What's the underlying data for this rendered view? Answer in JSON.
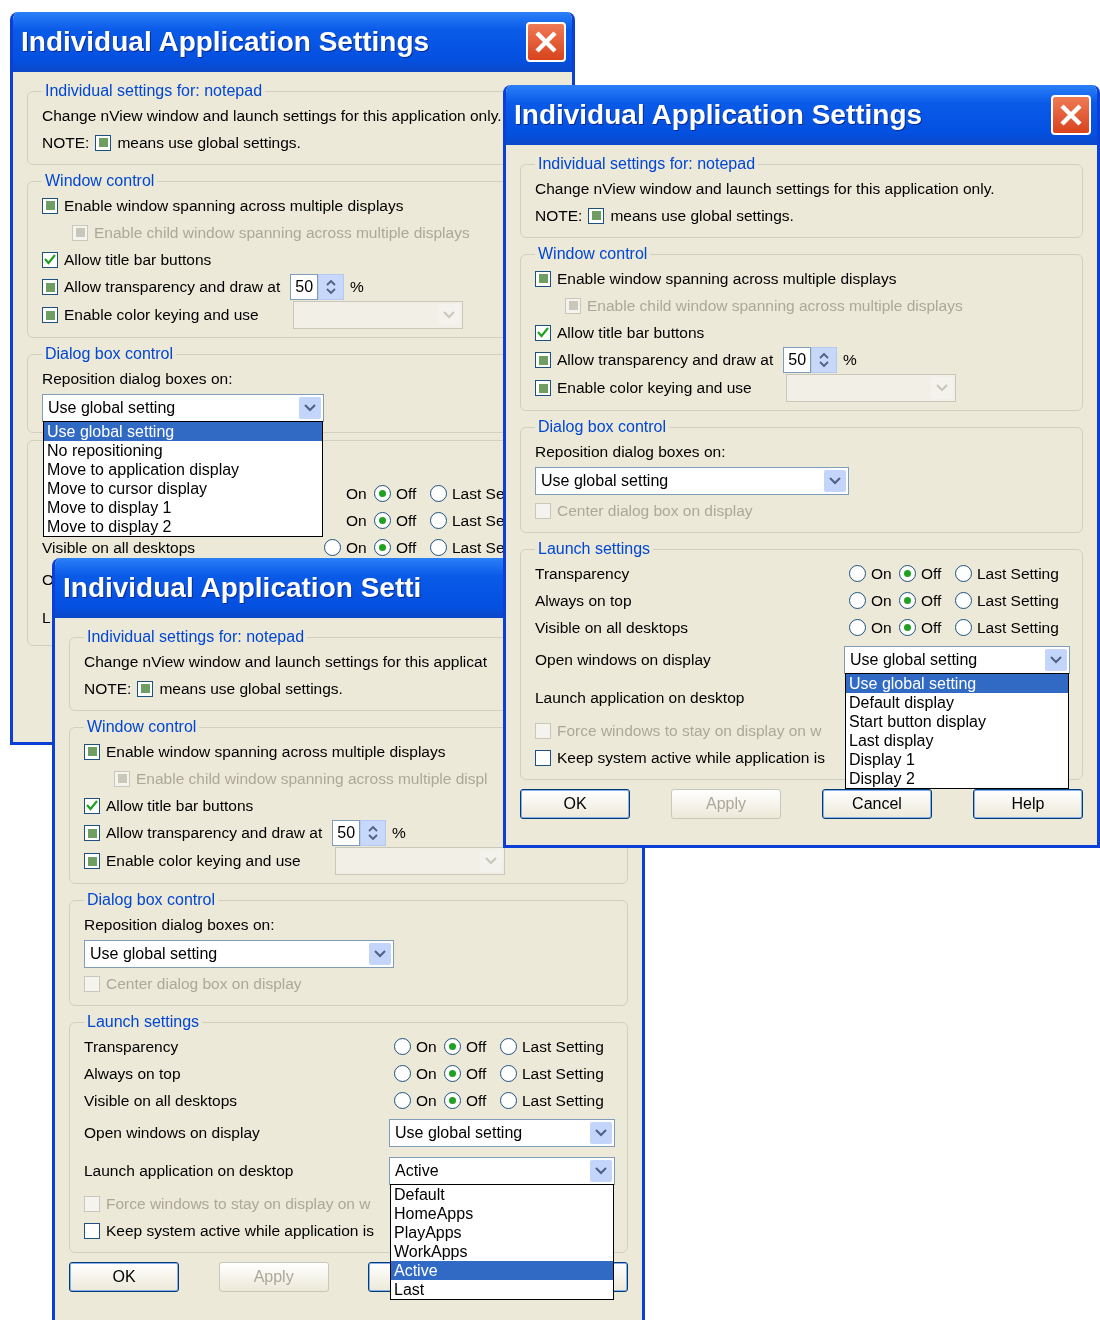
{
  "windows": [
    {
      "title": "Individual Application Settings",
      "close_button": true,
      "sections": [
        {
          "legend": "Individual settings for: notepad",
          "items": [
            {
              "kind": "text",
              "text": "Change nView window and launch settings for this application only."
            },
            {
              "kind": "note",
              "label": "NOTE:",
              "text": "means use global settings."
            }
          ]
        },
        {
          "legend": "Window control",
          "items": [
            {
              "kind": "checkbox",
              "checked": false,
              "indeterminate": true,
              "disabled": false,
              "label": "Enable window spanning across multiple displays",
              "children": [
                {
                  "kind": "checkbox",
                  "checked": false,
                  "indeterminate": true,
                  "disabled": true,
                  "label": "Enable child window spanning across multiple displays"
                }
              ]
            },
            {
              "kind": "checkbox",
              "checked": true,
              "disabled": false,
              "label": "Allow title bar buttons"
            },
            {
              "kind": "spin",
              "checked": false,
              "indeterminate": true,
              "label": "Allow transparency and draw at",
              "value": "50",
              "unit": "%"
            },
            {
              "kind": "select_check",
              "checked": false,
              "indeterminate": true,
              "label": "Enable color keying and use",
              "select_disabled": true
            }
          ]
        },
        {
          "legend": "Dialog box control",
          "items": [
            {
              "kind": "label",
              "text": "Reposition dialog boxes on:"
            },
            {
              "kind": "select",
              "value": "Use global setting",
              "list": [
                {
                  "label": "Use global setting",
                  "selected": true
                },
                {
                  "label": "No repositioning",
                  "selected": false
                },
                {
                  "label": "Move to application display",
                  "selected": false
                },
                {
                  "label": "Move to cursor display",
                  "selected": false
                },
                {
                  "label": "Move to display 1",
                  "selected": false
                },
                {
                  "label": "Move to display 2",
                  "selected": false
                }
              ]
            }
          ]
        },
        {
          "items": [
            {
              "kind": "radio_row",
              "options": [
                {
                  "label": "On"
                },
                {
                  "label": "Off",
                  "selected": true
                },
                {
                  "label": "Last Se",
                  "selected": false
                }
              ]
            },
            {
              "kind": "radio_row",
              "options": [
                {
                  "label": "On"
                },
                {
                  "label": "Off",
                  "selected": true
                },
                {
                  "label": "Last Se",
                  "selected": false
                }
              ]
            },
            {
              "kind": "radio_row",
              "label": "Visible on all desktops",
              "options": [
                {
                  "label": "On",
                  "selected": false
                },
                {
                  "label": "Off",
                  "selected": true
                },
                {
                  "label": "Last Se",
                  "selected": false
                }
              ]
            },
            {
              "kind": "select_row",
              "label": "O"
            },
            {
              "kind": "select_row",
              "label": "L"
            }
          ]
        }
      ]
    },
    {
      "title": "Individual Application Settings",
      "close_button": true,
      "sections": [
        {
          "legend": "Individual settings for: notepad",
          "items": [
            {
              "kind": "text",
              "text": "Change nView window and launch settings for this application only."
            },
            {
              "kind": "note",
              "label": "NOTE:",
              "text": "means use global settings."
            }
          ]
        },
        {
          "legend": "Window control",
          "items": [
            {
              "kind": "checkbox",
              "checked": false,
              "indeterminate": true,
              "disabled": false,
              "label": "Enable window spanning across multiple displays",
              "children": [
                {
                  "kind": "checkbox",
                  "checked": false,
                  "indeterminate": true,
                  "disabled": true,
                  "label": "Enable child window spanning across multiple displays"
                }
              ]
            },
            {
              "kind": "checkbox",
              "checked": true,
              "disabled": false,
              "label": "Allow title bar buttons"
            },
            {
              "kind": "spin",
              "checked": false,
              "indeterminate": true,
              "label": "Allow transparency and draw at",
              "value": "50",
              "unit": "%"
            },
            {
              "kind": "select_check",
              "checked": false,
              "indeterminate": true,
              "label": "Enable color keying and use",
              "select_disabled": true
            }
          ]
        },
        {
          "legend": "Dialog box control",
          "items": [
            {
              "kind": "label",
              "text": "Reposition dialog boxes on:"
            },
            {
              "kind": "select",
              "value": "Use global setting"
            },
            {
              "kind": "checkbox",
              "checked": false,
              "indeterminate": false,
              "disabled": true,
              "label": "Center dialog box on display"
            }
          ]
        },
        {
          "legend": "Launch settings",
          "items": [
            {
              "kind": "radio_row",
              "label": "Transparency",
              "options": [
                {
                  "label": "On",
                  "selected": false
                },
                {
                  "label": "Off",
                  "selected": true
                },
                {
                  "label": "Last Setting",
                  "selected": false
                }
              ]
            },
            {
              "kind": "radio_row",
              "label": "Always on top",
              "options": [
                {
                  "label": "On",
                  "selected": false
                },
                {
                  "label": "Off",
                  "selected": true
                },
                {
                  "label": "Last Setting",
                  "selected": false
                }
              ]
            },
            {
              "kind": "radio_row",
              "label": "Visible on all desktops",
              "options": [
                {
                  "label": "On",
                  "selected": false
                },
                {
                  "label": "Off",
                  "selected": true
                },
                {
                  "label": "Last Setting",
                  "selected": false
                }
              ]
            },
            {
              "kind": "select_row",
              "label": "Open windows on display",
              "value": "Use global setting",
              "list": [
                {
                  "label": "Use global setting",
                  "selected": true
                },
                {
                  "label": "Default display",
                  "selected": false
                },
                {
                  "label": "Start button display",
                  "selected": false
                },
                {
                  "label": "Last display",
                  "selected": false
                },
                {
                  "label": "Display 1",
                  "selected": false
                },
                {
                  "label": "Display 2",
                  "selected": false
                }
              ]
            },
            {
              "kind": "select_row",
              "label": "Launch application on desktop"
            },
            {
              "kind": "checkbox",
              "checked": false,
              "indeterminate": false,
              "disabled": true,
              "label": "Force windows to stay on display on w"
            },
            {
              "kind": "checkbox",
              "checked": false,
              "indeterminate": false,
              "disabled": false,
              "label": "Keep system active while application is"
            }
          ]
        }
      ],
      "buttons": [
        {
          "label": "OK",
          "disabled": false
        },
        {
          "label": "Apply",
          "disabled": true
        },
        {
          "label": "Cancel",
          "disabled": false
        },
        {
          "label": "Help",
          "disabled": false
        }
      ]
    },
    {
      "title": "Individual Application Setti",
      "sections": [
        {
          "legend": "Individual settings for: notepad",
          "items": [
            {
              "kind": "text",
              "text": "Change nView window and launch settings for this applicat"
            },
            {
              "kind": "note",
              "label": "NOTE:",
              "text": "means use global settings."
            }
          ]
        },
        {
          "legend": "Window control",
          "items": [
            {
              "kind": "checkbox",
              "checked": false,
              "indeterminate": true,
              "disabled": false,
              "label": "Enable window spanning across multiple displays",
              "children": [
                {
                  "kind": "checkbox",
                  "checked": false,
                  "indeterminate": true,
                  "disabled": true,
                  "label": "Enable child window spanning across multiple displ"
                }
              ]
            },
            {
              "kind": "checkbox",
              "checked": true,
              "disabled": false,
              "label": "Allow title bar buttons"
            },
            {
              "kind": "spin",
              "checked": false,
              "indeterminate": true,
              "label": "Allow transparency and draw at",
              "value": "50",
              "unit": "%"
            },
            {
              "kind": "select_check",
              "checked": false,
              "indeterminate": true,
              "label": "Enable color keying and use",
              "select_disabled": true
            }
          ]
        },
        {
          "legend": "Dialog box control",
          "items": [
            {
              "kind": "label",
              "text": "Reposition dialog boxes on:"
            },
            {
              "kind": "select",
              "value": "Use global setting"
            },
            {
              "kind": "checkbox",
              "checked": false,
              "indeterminate": false,
              "disabled": true,
              "label": "Center dialog box on display"
            }
          ]
        },
        {
          "legend": "Launch settings",
          "items": [
            {
              "kind": "radio_row",
              "label": "Transparency",
              "options": [
                {
                  "label": "On",
                  "selected": false
                },
                {
                  "label": "Off",
                  "selected": true
                },
                {
                  "label": "Last Setting",
                  "selected": false
                }
              ]
            },
            {
              "kind": "radio_row",
              "label": "Always on top",
              "options": [
                {
                  "label": "On",
                  "selected": false
                },
                {
                  "label": "Off",
                  "selected": true
                },
                {
                  "label": "Last Setting",
                  "selected": false
                }
              ]
            },
            {
              "kind": "radio_row",
              "label": "Visible on all desktops",
              "options": [
                {
                  "label": "On",
                  "selected": false
                },
                {
                  "label": "Off",
                  "selected": true
                },
                {
                  "label": "Last Setting",
                  "selected": false
                }
              ]
            },
            {
              "kind": "select_row",
              "label": "Open windows on display",
              "value": "Use global setting"
            },
            {
              "kind": "select_row",
              "label": "Launch application on desktop",
              "value": "Active",
              "list": [
                {
                  "label": "Default",
                  "selected": false
                },
                {
                  "label": "HomeApps",
                  "selected": false
                },
                {
                  "label": "PlayApps",
                  "selected": false
                },
                {
                  "label": "WorkApps",
                  "selected": false
                },
                {
                  "label": "Active",
                  "selected": true
                },
                {
                  "label": "Last",
                  "selected": false
                }
              ]
            },
            {
              "kind": "checkbox",
              "checked": false,
              "indeterminate": false,
              "disabled": true,
              "label": "Force windows to stay on display on w"
            },
            {
              "kind": "checkbox",
              "checked": false,
              "indeterminate": false,
              "disabled": false,
              "label": "Keep system active while application is"
            }
          ]
        }
      ],
      "buttons": [
        {
          "label": "OK",
          "disabled": false
        },
        {
          "label": "Apply",
          "disabled": true
        },
        {
          "disabled": false
        },
        {
          "disabled": false
        }
      ]
    }
  ]
}
